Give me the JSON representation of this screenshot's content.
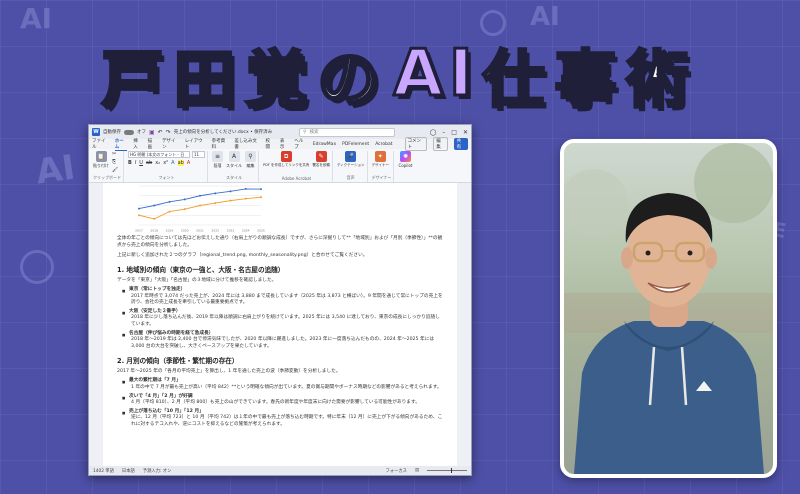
{
  "banner": {
    "title_prefix": "戸田覚の",
    "title_ai": "AI",
    "title_suffix": "仕事術",
    "ai_color": "#c9a6ff"
  },
  "decorations": {
    "ai_mark": "AI",
    "gen_mark": "GENE"
  },
  "word": {
    "autosave_label": "自動保存",
    "autosave_state": "オフ",
    "doc_title": "売上の傾向を分析してください.docx • 保存済み",
    "search_placeholder": "検索",
    "menu": [
      "ファイル",
      "ホーム",
      "挿入",
      "描画",
      "デザイン",
      "レイアウト",
      "参考資料",
      "差し込み文書",
      "校閲",
      "表示",
      "ヘルプ",
      "EdrawMax",
      "PDFelement",
      "Acrobat"
    ],
    "menu_active_index": 1,
    "comments_label": "コメント",
    "edit_label": "編集",
    "share_label": "共有",
    "font_name": "HG 明朝 (本文のフォント - 日",
    "font_size": "11",
    "ribbon": {
      "paste": "貼り付け",
      "clipboard_group": "クリップボード",
      "font_group": "フォント",
      "paragraph": "段落",
      "styles": "スタイル",
      "styles_group": "スタイル",
      "edit": "編集",
      "pdf_link": "PDF を作成してリンクを共有",
      "pdf_share": "署名を依頼",
      "acrobat_group": "Adobe Acrobat",
      "dictate": "ディクテーション",
      "voice_group": "音声",
      "designer": "デザイナー",
      "designer_group": "デザイナー",
      "copilot": "Copilot"
    },
    "icon_names": [
      "word-logo-icon",
      "save-icon",
      "undo-icon",
      "redo-icon",
      "search-icon",
      "paste-icon",
      "copilot-icon"
    ],
    "document": {
      "intro": "全体の年ごとの傾向については先ほどお伝えした通り（右肩上がりの順調な成長）ですが、さらに深掘りして**「地域別」および「月別（季節性）」**の観点から売上の傾向を分析しました。",
      "intro2": "上記に新しく追加された２つのグラフ（regional_trend.png, monthly_seasonality.png）と合わせてご覧ください。",
      "h1": "1. 地域別の傾向（東京の一強と、大阪・名古屋の追随）",
      "h1_intro": "データを「東京」「大阪」「名古屋」の３地域に分けて推移を確認しました。",
      "h1_items": [
        {
          "head": "東京（常にトップを独走）",
          "text": "2017 年時点で 3,074 だった売上が、2024 年には 3,880 まで成長しています（2025 年は 3,873 と横ばい）。9 年間を通じて常にトップの売上を誇り、会社の売上成長を牽引している最重要拠点です。"
        },
        {
          "head": "大阪（安定した２番手）",
          "text": "2018 年に少し落ち込んだ後、2019 年以降は順調に右肩上がりを続けています。2025 年には 3,540 に達しており、東京の成長にしっかり追随しています。"
        },
        {
          "head": "名古屋（伸び悩みの時期を経て急成長）",
          "text": "2018 年～2019 年は 2,400 台で停滞気味でしたが、2020 年以降に躍進しました。2023 年に一度落ち込んだものの、2024 年～2025 年には 3,000 台の大台を突破し、大きくペースアップを果たしています。"
        }
      ],
      "h2": "2. 月別の傾向（季節性・繁忙期の存在）",
      "h2_intro": "2017 年～2025 年の「各月の平均売上」を算出し、1 年を通した売上の波（季節変動）を分析しました。",
      "h2_items": [
        {
          "head": "最大の繁忙期は「7 月」",
          "text": "1 年の中で 7 月が最も売上が高い（平均 842）**という明確な傾向が出ています。夏の賞与期間やボーナス時期などの影響があると考えられます。"
        },
        {
          "head": "次いで「4 月」「2 月」が好調",
          "text": "4 月（平均 810）、2 月（平均 800）も売上の山ができています。春先の新年度や年度末に向けた需要が影響している可能性があります。"
        },
        {
          "head": "売上が落ち込む「10 月」「12 月」",
          "text": "逆に、12 月（平均 723）と 10 月（平均 742）は１年の中で最も売上が落ち込む時期です。特に年末（12 月）に売上が下がる傾向があるため、これに対するテコ入れや、逆にコストを抑えるなどの施策が考えられます。"
        }
      ]
    },
    "status": {
      "words": "1402 単語",
      "lang": "日本語",
      "predict": "予測入力: オン",
      "focus": "フォーカス"
    }
  },
  "chart_data": {
    "type": "line",
    "x": [
      2017,
      2018,
      2019,
      2020,
      2021,
      2022,
      2023,
      2024,
      2025
    ],
    "series": [
      {
        "values": [
          3074,
          3200,
          3350,
          3450,
          3600,
          3700,
          3780,
          3880,
          3873
        ],
        "color": "#3b6fd1"
      },
      {
        "values": [
          2800,
          2650,
          2950,
          3050,
          3200,
          3300,
          3400,
          3480,
          3540
        ],
        "color": "#f0a030"
      }
    ],
    "ylim": [
      2400,
      4000
    ],
    "grid": true
  }
}
